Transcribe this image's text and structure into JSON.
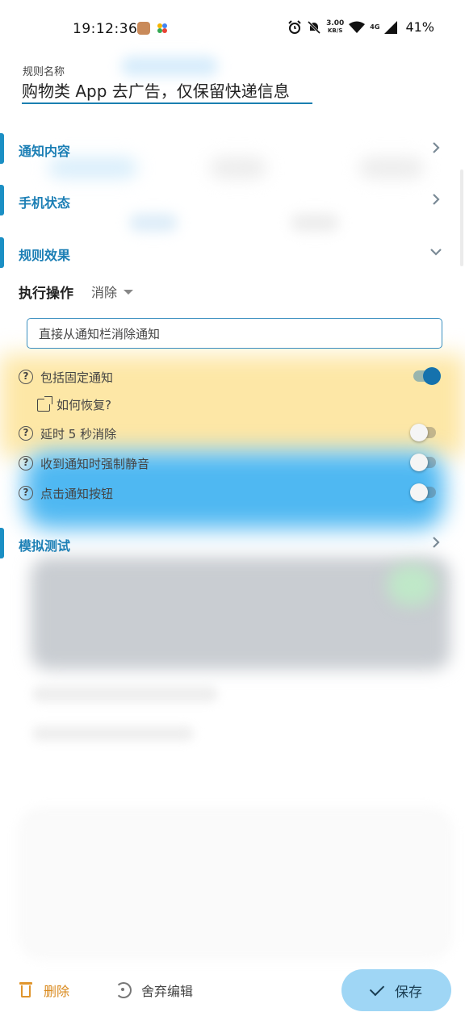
{
  "status_bar": {
    "time": "19:12:36",
    "net_speed_value": "3.00",
    "net_speed_unit": "KB/S",
    "network_type": "4G",
    "battery": "41%"
  },
  "rule": {
    "name_label": "规则名称",
    "name_value": "购物类 App 去广告，仅保留快递信息"
  },
  "sections": {
    "notification_content": "通知内容",
    "phone_state": "手机状态",
    "rule_effect": "规则效果",
    "simulate_test": "模拟测试"
  },
  "action": {
    "label": "执行操作",
    "selected": "消除",
    "description": "直接从通知栏消除通知"
  },
  "options": [
    {
      "label": "包括固定通知",
      "enabled": true
    },
    {
      "label": "延时 5 秒消除",
      "enabled": false
    },
    {
      "label": "收到通知时强制静音",
      "enabled": false
    },
    {
      "label": "点击通知按钮",
      "enabled": false
    }
  ],
  "recover_link": "如何恢复?",
  "bottom": {
    "delete": "删除",
    "discard": "舍弃编辑",
    "save": "保存"
  },
  "colors": {
    "accent": "#1c7fb5",
    "delete": "#d9881a",
    "save_bg": "#9fd6f5"
  }
}
